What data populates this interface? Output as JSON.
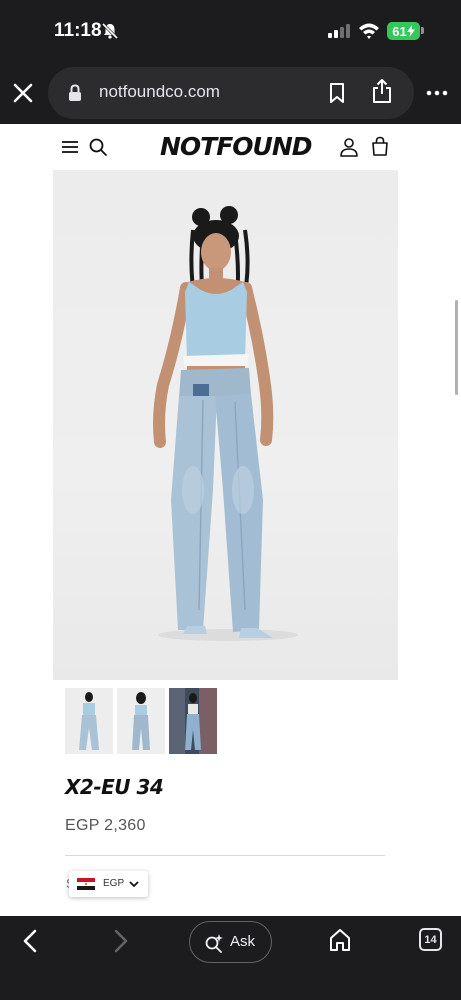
{
  "status_bar": {
    "time": "11:18",
    "battery": "61",
    "icons": [
      "bell-slash-icon",
      "cellular-signal-icon",
      "wifi-icon",
      "battery-charging-icon"
    ]
  },
  "browser": {
    "url": "notfoundco.com",
    "icons": [
      "close-icon",
      "lock-icon",
      "bookmark-icon",
      "share-icon",
      "more-icon"
    ]
  },
  "site_header": {
    "logo_text": "NOTFOUND",
    "icons": [
      "hamburger-menu-icon",
      "search-icon",
      "account-icon",
      "shopping-bag-icon"
    ]
  },
  "product": {
    "title": "X2-EU 34",
    "price": "EGP 2,360",
    "thumbnail_count": 3,
    "active_thumbnail": 0
  },
  "currency_selector": {
    "code": "EGP",
    "partial_label": "S"
  },
  "toolbar": {
    "ask_label": "Ask",
    "tabs_count": "14",
    "icons": [
      "back-arrow-icon",
      "forward-arrow-icon",
      "sparkle-search-icon",
      "home-icon",
      "tabs-icon"
    ]
  },
  "colors": {
    "chrome_dark": "#1c1c1e",
    "url_box": "#2c2c2e",
    "battery_green": "#34c759",
    "denim": "#a9c2d6",
    "top_blue": "#a8cde2"
  }
}
